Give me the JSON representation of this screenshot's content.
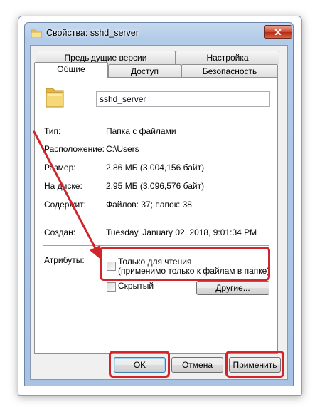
{
  "window": {
    "title": "Свойства: sshd_server",
    "close_glyph": "✕"
  },
  "tabs_row1": [
    {
      "label": "Предыдущие версии"
    },
    {
      "label": "Настройка"
    }
  ],
  "tabs_row2": [
    {
      "label": "Общие",
      "active": true
    },
    {
      "label": "Доступ"
    },
    {
      "label": "Безопасность"
    }
  ],
  "general": {
    "folder_name": "sshd_server",
    "type_label": "Тип:",
    "type_value": "Папка с файлами",
    "location_label": "Расположение:",
    "location_value": "C:\\Users",
    "size_label": "Размер:",
    "size_value": "2.86 МБ (3,004,156 байт)",
    "disk_label": "На диске:",
    "disk_value": "2.95 МБ (3,096,576 байт)",
    "contains_label": "Содержит:",
    "contains_value": "Файлов: 37; папок: 38",
    "created_label": "Создан:",
    "created_value": "Tuesday, January 02, 2018, 9:01:34 PM",
    "attributes_label": "Атрибуты:",
    "readonly_label": "Только для чтения",
    "readonly_note": "(применимо только к файлам в папке)",
    "hidden_label": "Скрытый",
    "other_button": "Другие..."
  },
  "buttons": {
    "ok": "OK",
    "cancel": "Отмена",
    "apply": "Применить"
  },
  "colors": {
    "annotation_red": "#d0252a",
    "folder_yellow": "#f3d36e"
  },
  "icons": [
    "folder-icon",
    "close-icon"
  ]
}
